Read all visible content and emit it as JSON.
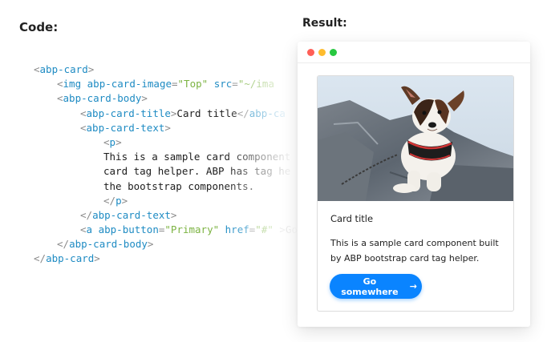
{
  "headings": {
    "code": "Code:",
    "result": "Result:"
  },
  "code_lines": [
    {
      "indent": 0,
      "tokens": [
        {
          "c": "p",
          "v": "<"
        },
        {
          "c": "t",
          "v": "abp-card"
        },
        {
          "c": "p",
          "v": ">"
        }
      ]
    },
    {
      "indent": 1,
      "tokens": [
        {
          "c": "p",
          "v": "<"
        },
        {
          "c": "t",
          "v": "img"
        },
        {
          "c": "txt",
          "v": " "
        },
        {
          "c": "a",
          "v": "abp-card-image"
        },
        {
          "c": "p",
          "v": "="
        },
        {
          "c": "s",
          "v": "\"Top\""
        },
        {
          "c": "txt",
          "v": " "
        },
        {
          "c": "a",
          "v": "src"
        },
        {
          "c": "p",
          "v": "="
        },
        {
          "c": "s",
          "v": "\"~/ima"
        }
      ]
    },
    {
      "indent": 1,
      "tokens": [
        {
          "c": "p",
          "v": "<"
        },
        {
          "c": "t",
          "v": "abp-card-body"
        },
        {
          "c": "p",
          "v": ">"
        }
      ]
    },
    {
      "indent": 2,
      "tokens": [
        {
          "c": "p",
          "v": "<"
        },
        {
          "c": "t",
          "v": "abp-card-title"
        },
        {
          "c": "p",
          "v": ">"
        },
        {
          "c": "txt",
          "v": "Card title"
        },
        {
          "c": "p",
          "v": "</"
        },
        {
          "c": "t",
          "v": "abp-ca"
        }
      ]
    },
    {
      "indent": 2,
      "tokens": [
        {
          "c": "p",
          "v": "<"
        },
        {
          "c": "t",
          "v": "abp-card-text"
        },
        {
          "c": "p",
          "v": ">"
        }
      ]
    },
    {
      "indent": 3,
      "tokens": [
        {
          "c": "p",
          "v": "<"
        },
        {
          "c": "t",
          "v": "p"
        },
        {
          "c": "p",
          "v": ">"
        }
      ]
    },
    {
      "indent": 3,
      "tokens": [
        {
          "c": "txt",
          "v": "This is a sample card component"
        }
      ]
    },
    {
      "indent": 3,
      "tokens": [
        {
          "c": "txt",
          "v": "card tag helper. ABP has tag he"
        }
      ]
    },
    {
      "indent": 3,
      "tokens": [
        {
          "c": "txt",
          "v": "the bootstrap components."
        }
      ]
    },
    {
      "indent": 3,
      "tokens": [
        {
          "c": "p",
          "v": "</"
        },
        {
          "c": "t",
          "v": "p"
        },
        {
          "c": "p",
          "v": ">"
        }
      ]
    },
    {
      "indent": 2,
      "tokens": [
        {
          "c": "p",
          "v": "</"
        },
        {
          "c": "t",
          "v": "abp-card-text"
        },
        {
          "c": "p",
          "v": ">"
        }
      ]
    },
    {
      "indent": 2,
      "tokens": [
        {
          "c": "p",
          "v": "<"
        },
        {
          "c": "t",
          "v": "a"
        },
        {
          "c": "txt",
          "v": " "
        },
        {
          "c": "a",
          "v": "abp-button"
        },
        {
          "c": "p",
          "v": "="
        },
        {
          "c": "s",
          "v": "\"Primary\""
        },
        {
          "c": "txt",
          "v": " "
        },
        {
          "c": "a",
          "v": "href"
        },
        {
          "c": "p",
          "v": "="
        },
        {
          "c": "s",
          "v": "\"#\""
        },
        {
          "c": "txt",
          "v": " "
        },
        {
          "c": "p",
          "v": ">"
        },
        {
          "c": "txt",
          "v": "Go"
        }
      ]
    },
    {
      "indent": 1,
      "tokens": [
        {
          "c": "p",
          "v": "</"
        },
        {
          "c": "t",
          "v": "abp-card-body"
        },
        {
          "c": "p",
          "v": ">"
        }
      ]
    },
    {
      "indent": 0,
      "tokens": [
        {
          "c": "p",
          "v": "</"
        },
        {
          "c": "t",
          "v": "abp-card"
        },
        {
          "c": "p",
          "v": ">"
        }
      ]
    }
  ],
  "window": {
    "dots": [
      "#ff5f57",
      "#febc2e",
      "#28c840"
    ]
  },
  "card": {
    "image_icon": "dog-photo",
    "title": "Card title",
    "text": "This is a sample card component built by ABP bootstrap card tag helper.",
    "button_label": "Go somewhere",
    "button_arrow": "→",
    "button_color": "#0a84ff"
  }
}
